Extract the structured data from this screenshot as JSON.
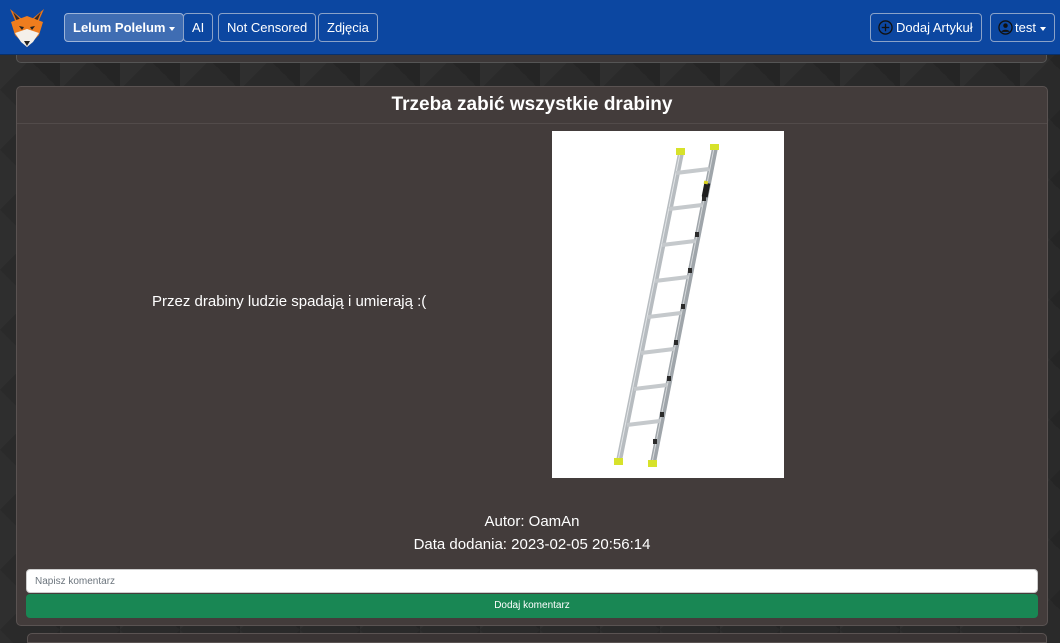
{
  "navbar": {
    "logo_icon": "fox-logo-icon",
    "items": [
      {
        "label": "Lelum Polelum",
        "dropdown": true,
        "active": true
      },
      {
        "label": "AI"
      },
      {
        "label": "Not Censored"
      },
      {
        "label": "Zdjęcia"
      }
    ],
    "add_article": {
      "label": "Dodaj Artykuł",
      "icon": "plus-circle-icon"
    },
    "user": {
      "label": "test",
      "icon": "user-circle-icon",
      "dropdown": true
    }
  },
  "article": {
    "title": "Trzeba zabić wszystkie drabiny",
    "body": "Przez drabiny ludzie spadają i umierają :(",
    "image_alt": "ladder",
    "author": "Autor: OamAn",
    "date": "Data dodania: 2023-02-05 20:56:14"
  },
  "comment": {
    "placeholder": "Napisz komentarz",
    "submit_label": "Dodaj komentarz"
  },
  "colors": {
    "navbar": "#0c47a1",
    "card": "#433c3b",
    "submit": "#198754"
  }
}
